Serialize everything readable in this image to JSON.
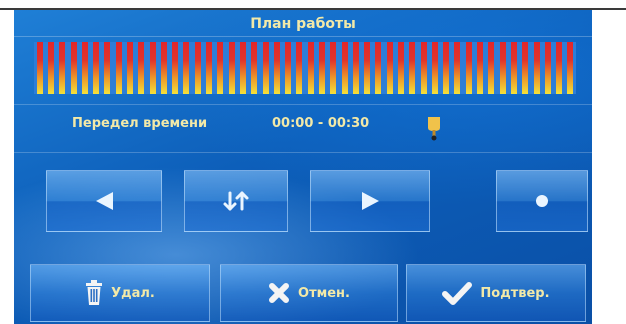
{
  "header": {
    "title": "План работы"
  },
  "time_range": {
    "label": "Передел времени",
    "value": "00:00 - 00:30"
  },
  "nav": {
    "buttons": [
      {
        "name": "prev",
        "icon": "arrow-left-icon"
      },
      {
        "name": "swap",
        "icon": "swap-vertical-icon"
      },
      {
        "name": "next",
        "icon": "play-icon"
      },
      {
        "name": "dot",
        "icon": "dot-icon"
      }
    ]
  },
  "footer": {
    "delete_label": "Удал.",
    "cancel_label": "Отмен.",
    "confirm_label": "Подтвер."
  },
  "colors": {
    "text": "#f2e9a8",
    "background": "#0d5fba",
    "bar_top": "#e2262b",
    "bar_bottom": "#f3e13a"
  }
}
